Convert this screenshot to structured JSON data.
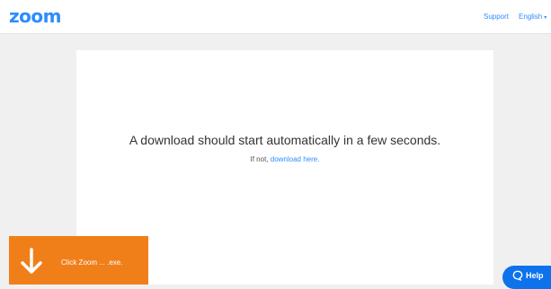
{
  "header": {
    "logo": "zoom",
    "support_label": "Support",
    "language_label": "English",
    "language_caret": "▾"
  },
  "main": {
    "message": "A download should start automatically in a few seconds.",
    "fallback_prefix": "If not, ",
    "fallback_link": "download here."
  },
  "download_toast": {
    "text": "Click Zoom ... .exe.",
    "icon": "down-arrow-icon"
  },
  "help_button": {
    "label": "Help",
    "icon": "chat-bubble-icon"
  },
  "colors": {
    "brand": "#2d8cff",
    "toast": "#f07f1a",
    "help": "#0e72ed",
    "background": "#f0f0f0"
  }
}
